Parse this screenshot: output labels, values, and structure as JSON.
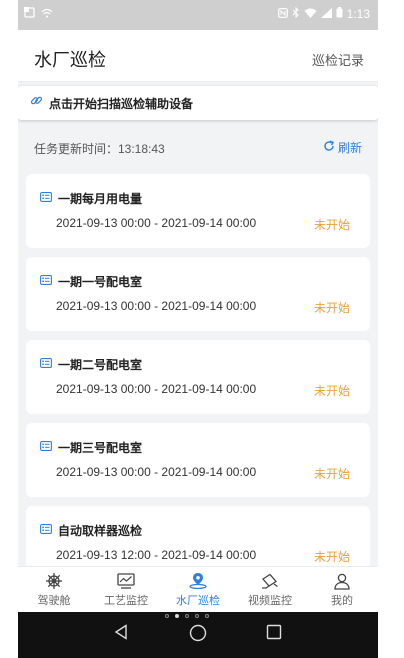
{
  "status_bar": {
    "time": "1:13"
  },
  "header": {
    "title": "水厂巡检",
    "record_link": "巡检记录"
  },
  "scan": {
    "text": "点击开始扫描巡检辅助设备"
  },
  "update": {
    "label": "任务更新时间：13:18:43",
    "refresh_label": "刷新"
  },
  "tasks": [
    {
      "title": "一期每月用电量",
      "time": "2021-09-13 00:00 - 2021-09-14 00:00",
      "status": "未开始"
    },
    {
      "title": "一期一号配电室",
      "time": "2021-09-13 00:00 - 2021-09-14 00:00",
      "status": "未开始"
    },
    {
      "title": "一期二号配电室",
      "time": "2021-09-13 00:00 - 2021-09-14 00:00",
      "status": "未开始"
    },
    {
      "title": "一期三号配电室",
      "time": "2021-09-13 00:00 - 2021-09-14 00:00",
      "status": "未开始"
    },
    {
      "title": "自动取样器巡检",
      "time": "2021-09-13 12:00 - 2021-09-14 00:00",
      "status": "未开始"
    }
  ],
  "nav": [
    {
      "label": "驾驶舱",
      "icon": "helm-icon"
    },
    {
      "label": "工艺监控",
      "icon": "monitor-chart-icon"
    },
    {
      "label": "水厂巡检",
      "icon": "location-pin-icon"
    },
    {
      "label": "视频监控",
      "icon": "camera-icon"
    },
    {
      "label": "我的",
      "icon": "user-icon"
    }
  ],
  "colors": {
    "accent": "#2f7fdc",
    "status_pending": "#e8a13c"
  }
}
